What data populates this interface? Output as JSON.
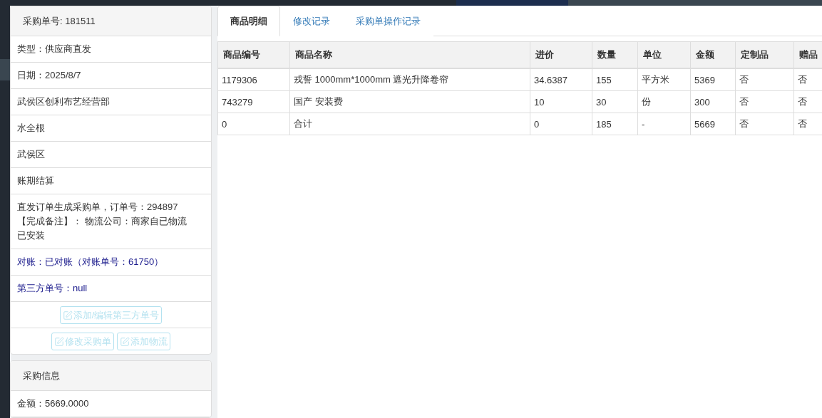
{
  "order_panel": {
    "header": "采购单号: 181511",
    "rows": [
      {
        "kind": "plain",
        "lines": [
          "类型：供应商直发"
        ]
      },
      {
        "kind": "plain",
        "lines": [
          "日期：2025/8/7"
        ]
      },
      {
        "kind": "plain",
        "lines": [
          "武侯区创利布艺经营部"
        ]
      },
      {
        "kind": "plain",
        "lines": [
          "水全根"
        ]
      },
      {
        "kind": "plain",
        "lines": [
          "武侯区"
        ]
      },
      {
        "kind": "plain",
        "lines": [
          "账期结算"
        ]
      },
      {
        "kind": "plain",
        "lines": [
          "直发订单生成采购单，订单号：294897",
          "【完成备注】： 物流公司：商家自已物流",
          "已安装"
        ]
      },
      {
        "kind": "accent",
        "lines": [
          "对账：已对账（对账单号：61750）"
        ]
      },
      {
        "kind": "accent",
        "lines": [
          "第三方单号：null"
        ]
      }
    ],
    "button_rows": [
      [
        {
          "label": "添加/编辑第三方单号",
          "disabled": true
        }
      ],
      [
        {
          "label": "修改采购单",
          "disabled": true
        },
        {
          "label": "添加物流",
          "disabled": true
        }
      ]
    ]
  },
  "info_panel": {
    "header": "采购信息",
    "rows": [
      {
        "kind": "plain",
        "lines": [
          "金额：5669.0000"
        ]
      }
    ]
  },
  "tabs": [
    {
      "label": "商品明细",
      "selected": true
    },
    {
      "label": "修改记录",
      "selected": false
    },
    {
      "label": "采购单操作记录",
      "selected": false
    }
  ],
  "table": {
    "columns": [
      "商品编号",
      "商品名称",
      "进价",
      "数量",
      "单位",
      "金额",
      "定制品",
      "赠品"
    ],
    "rows": [
      [
        "1179306",
        "戎誓 1000mm*1000mm 遮光升降卷帘",
        "34.6387",
        "155",
        "平方米",
        "5369",
        "否",
        "否"
      ],
      [
        "743279",
        "国产 安装费",
        "10",
        "30",
        "份",
        "300",
        "否",
        "否"
      ],
      [
        "0",
        "合计",
        "0",
        "185",
        "-",
        "5669",
        "否",
        "否"
      ]
    ]
  }
}
